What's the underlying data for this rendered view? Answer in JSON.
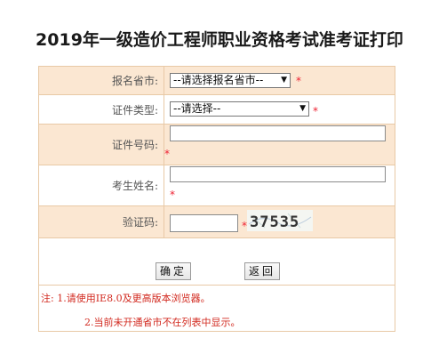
{
  "page": {
    "title": "2019年一级造价工程师职业资格考试准考证打印"
  },
  "form": {
    "province_label": "报名省市:",
    "province_value": "--请选择报名省市--",
    "idtype_label": "证件类型:",
    "idtype_value": "--请选择--",
    "idnum_label": "证件号码:",
    "name_label": "考生姓名:",
    "captcha_label": "验证码:",
    "captcha_text": "37535",
    "required_mark": "*"
  },
  "buttons": {
    "confirm": "确定",
    "back": "返回"
  },
  "notes": {
    "line1": "注: 1.请使用IE8.0及更高版本浏览器。",
    "line2": "2.当前未开通省市不在列表中显示。"
  },
  "colors": {
    "border": "#e8c9a6",
    "shaded": "#fbe7d2",
    "required": "#e23333"
  }
}
